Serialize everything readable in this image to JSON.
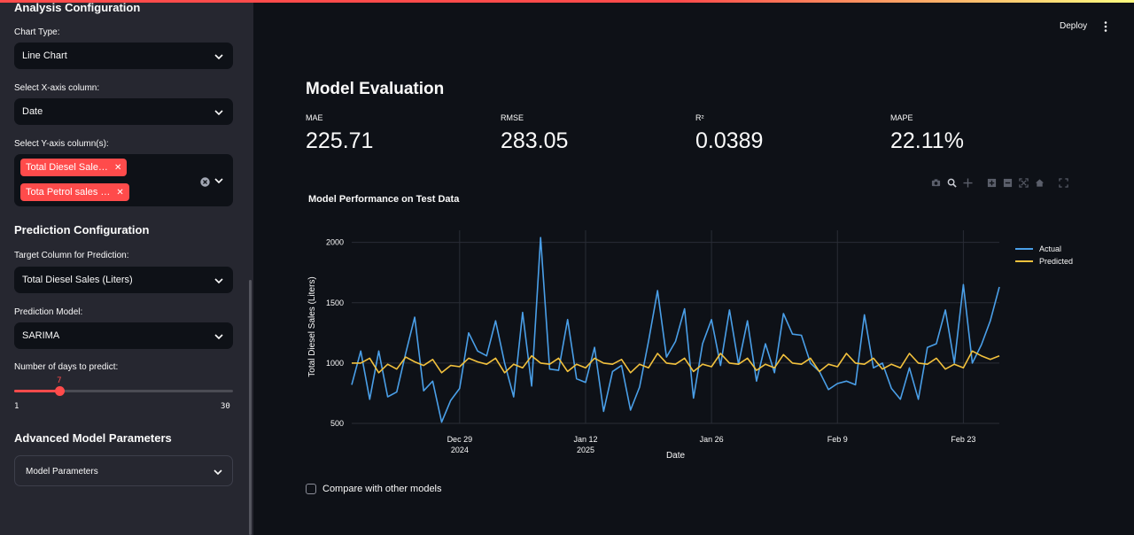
{
  "sidebar": {
    "analysis_heading": "Analysis Configuration",
    "chart_type_label": "Chart Type:",
    "chart_type_value": "Line Chart",
    "x_axis_label": "Select X-axis column:",
    "x_axis_value": "Date",
    "y_axis_label": "Select Y-axis column(s):",
    "y_axis_tags": [
      "Total Diesel Sale…",
      "Tota Petrol sales …"
    ],
    "prediction_heading": "Prediction Configuration",
    "target_label": "Target Column for Prediction:",
    "target_value": "Total Diesel Sales (Liters)",
    "model_label": "Prediction Model:",
    "model_value": "SARIMA",
    "days_label": "Number of days to predict:",
    "days_value": "7",
    "days_value_num": 7,
    "days_min": "1",
    "days_max": "30",
    "advanced_heading": "Advanced Model Parameters",
    "params_expander": "Model Parameters"
  },
  "header": {
    "deploy_label": "Deploy"
  },
  "main": {
    "title": "Model Evaluation",
    "metrics": [
      {
        "label": "MAE",
        "value": "225.71"
      },
      {
        "label": "RMSE",
        "value": "283.05"
      },
      {
        "label": "R²",
        "value": "0.0389"
      },
      {
        "label": "MAPE",
        "value": "22.11%"
      }
    ],
    "compare_label": "Compare with other models"
  },
  "colors": {
    "accent": "#ff4b4b",
    "actual": "#4a9fe8",
    "predicted": "#f2c13d"
  },
  "chart_data": {
    "type": "line",
    "title": "Model Performance on Test Data",
    "xlabel": "Date",
    "ylabel": "Total Diesel Sales (Liters)",
    "ylim": [
      500,
      2100
    ],
    "yticks": [
      500,
      1000,
      1500,
      2000
    ],
    "x_start": "2024-12-17",
    "x_ticks": [
      {
        "date": "2024-12-29",
        "label": "Dec 29",
        "sub": "2024"
      },
      {
        "date": "2025-01-12",
        "label": "Jan 12",
        "sub": "2025"
      },
      {
        "date": "2025-01-26",
        "label": "Jan 26",
        "sub": ""
      },
      {
        "date": "2025-02-09",
        "label": "Feb 9",
        "sub": ""
      },
      {
        "date": "2025-02-23",
        "label": "Feb 23",
        "sub": ""
      }
    ],
    "series": [
      {
        "name": "Actual",
        "color": "#4a9fe8",
        "values": [
          820,
          1100,
          700,
          1100,
          720,
          760,
          1080,
          1380,
          770,
          850,
          510,
          690,
          790,
          1250,
          1100,
          1060,
          1350,
          1000,
          720,
          1420,
          810,
          2040,
          950,
          940,
          1360,
          870,
          840,
          1130,
          600,
          930,
          980,
          610,
          800,
          1180,
          1600,
          1050,
          1180,
          1450,
          710,
          1160,
          1360,
          980,
          1440,
          990,
          1350,
          850,
          1160,
          920,
          1410,
          1240,
          1230,
          1000,
          930,
          780,
          830,
          850,
          820,
          1400,
          960,
          1000,
          790,
          700,
          960,
          700,
          1130,
          1160,
          1440,
          1000,
          1650,
          1000,
          1150,
          1350,
          1630
        ]
      },
      {
        "name": "Predicted",
        "color": "#f2c13d",
        "values": [
          1000,
          1000,
          1040,
          920,
          990,
          950,
          1050,
          1010,
          980,
          1030,
          920,
          980,
          970,
          1040,
          1010,
          990,
          1040,
          920,
          990,
          960,
          1060,
          1000,
          990,
          1040,
          930,
          990,
          960,
          1040,
          1000,
          990,
          1030,
          920,
          990,
          960,
          1080,
          1000,
          990,
          1040,
          930,
          990,
          970,
          1080,
          1000,
          990,
          1040,
          940,
          990,
          960,
          1070,
          1000,
          990,
          1040,
          930,
          990,
          970,
          1080,
          1000,
          990,
          1040,
          950,
          990,
          960,
          1080,
          1000,
          990,
          1040,
          950,
          990,
          960,
          1100,
          1060,
          1030,
          1060
        ]
      }
    ]
  }
}
